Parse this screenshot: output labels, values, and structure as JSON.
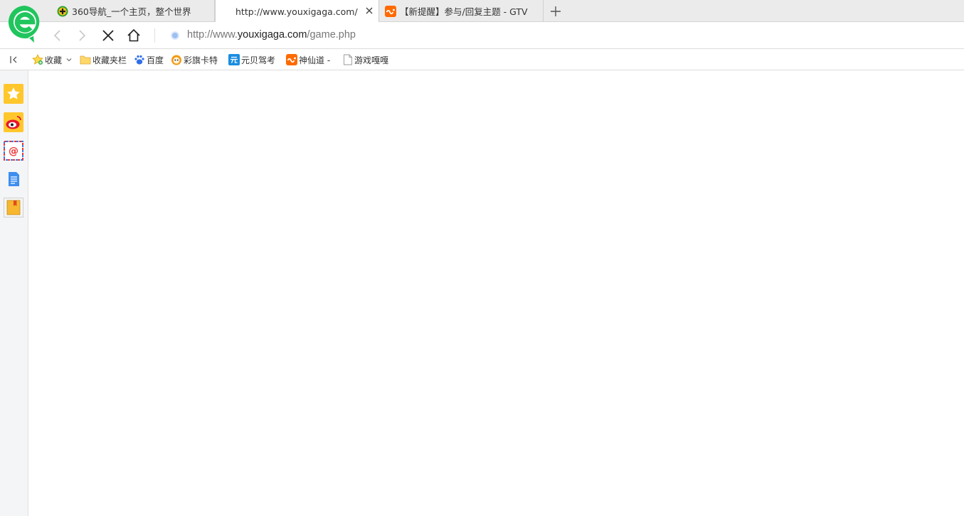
{
  "tabs": [
    {
      "title": "360导航_一个主页，整个世界",
      "icon": "360-nav-icon",
      "state": "inactive"
    },
    {
      "title": "http://www.youxigaga.com/ga",
      "icon": "none",
      "state": "active"
    },
    {
      "title": "【新提醒】参与/回复主题 - GTV",
      "icon": "gtv-icon",
      "state": "inactive"
    }
  ],
  "address": {
    "scheme": "http://www.",
    "host": "youxigaga.com",
    "path": "/game.php"
  },
  "bookmarks": [
    {
      "label": "收藏",
      "icon": "star-icon"
    },
    {
      "label": "收藏夹栏",
      "icon": "folder-icon"
    },
    {
      "label": "百度",
      "icon": "baidu-paw-icon"
    },
    {
      "label": "彩旗卡特",
      "icon": "orange-face-icon"
    },
    {
      "label": "元贝驾考",
      "icon": "yuanbei-icon"
    },
    {
      "label": "神仙道 -",
      "icon": "gtv-icon"
    },
    {
      "label": "游戏嘎嘎",
      "icon": "page-icon"
    }
  ],
  "colors": {
    "brand_green": "#21c55d",
    "sidebar_bg": "#f4f5f6",
    "tabstrip_bg": "#ebebeb",
    "accent_orange": "#ff6a00"
  }
}
